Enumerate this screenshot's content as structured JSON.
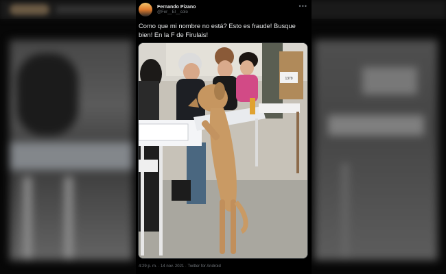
{
  "tweet": {
    "display_name": "Fernando Pizano",
    "handle": "@Fer__El__colo",
    "text": "Como que mi nombre no está? Esto es fraude! Busque bien! En la F de Firulais!",
    "meta": "4:29 p. m. · 14 nov. 2021 · Twitter for Android",
    "more_icon": "more-options-icon",
    "colors": {
      "background": "#000000",
      "text": "#e7e9ea",
      "secondary": "#71767b"
    }
  },
  "media": {
    "box_label": "1379"
  }
}
